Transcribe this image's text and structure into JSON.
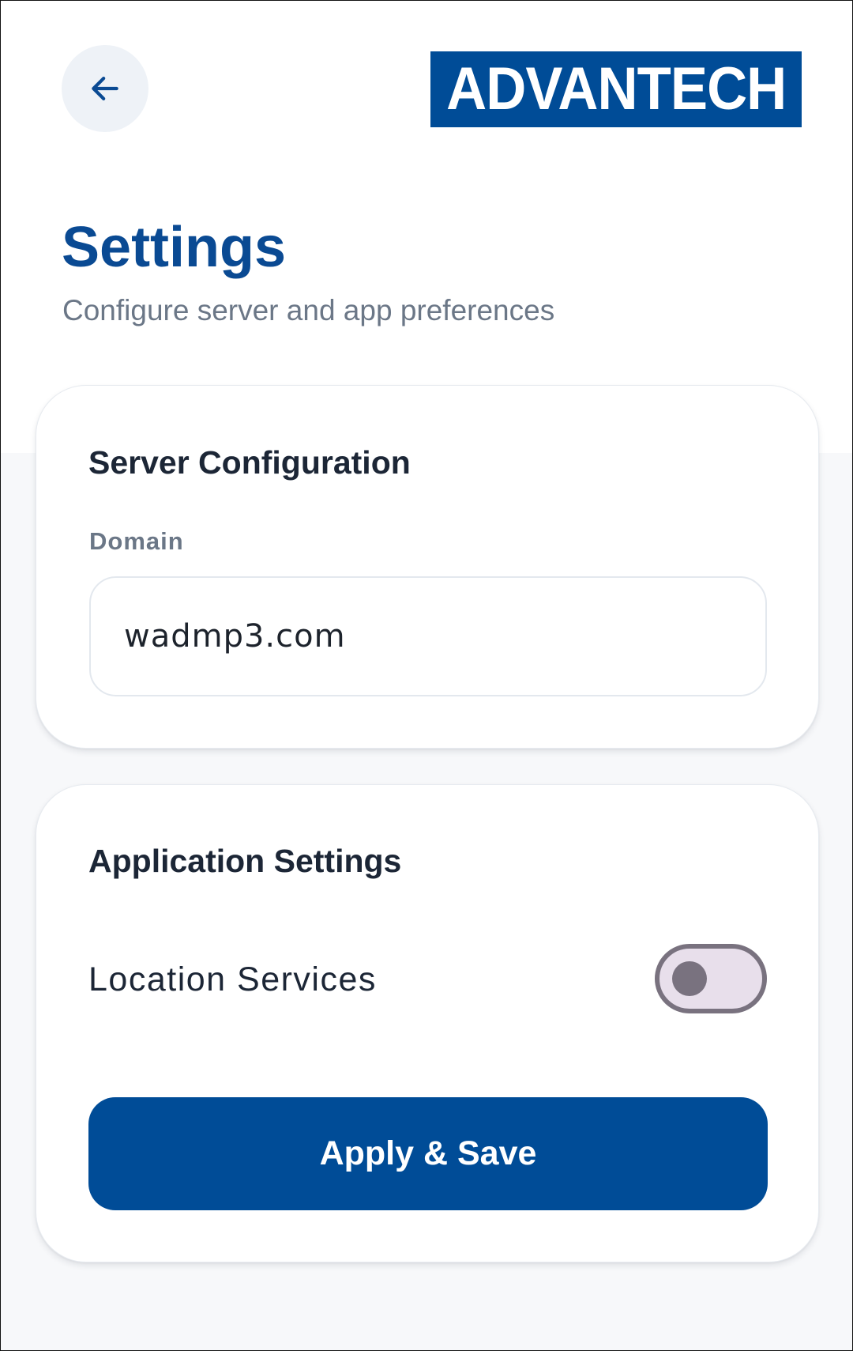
{
  "header": {
    "back_icon": "arrow-left-icon",
    "logo_text": "ADVANTECH"
  },
  "page": {
    "title": "Settings",
    "subtitle": "Configure server and app preferences"
  },
  "server_configuration": {
    "title": "Server Configuration",
    "domain_label": "Domain",
    "domain_value": "wadmp3.com"
  },
  "application_settings": {
    "title": "Application Settings",
    "location_services": {
      "label": "Location Services",
      "enabled": false
    },
    "apply_button_label": "Apply & Save"
  },
  "colors": {
    "brand_blue": "#004c97",
    "title_blue": "#0a4a93",
    "muted_text": "#6b7787",
    "dark_text": "#1c2636",
    "toggle_off": "#79727f",
    "toggle_track": "#e8dfeb"
  }
}
